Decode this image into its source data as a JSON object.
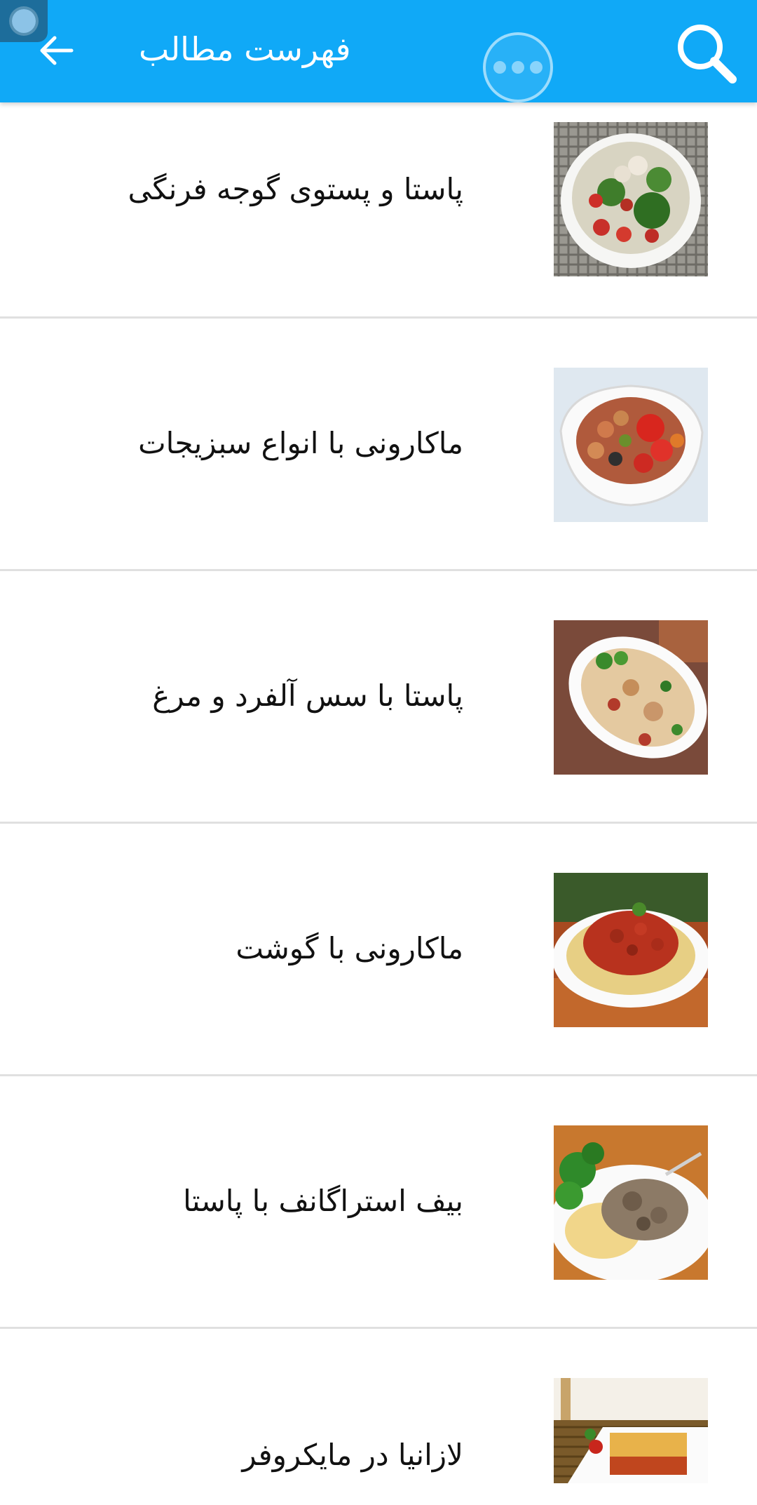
{
  "header": {
    "title": "فهرست مطالب",
    "accent_color": "#10a9f7",
    "back_icon": "arrow-left-icon",
    "search_icon": "search-icon",
    "overflow_icon": "more-dots-icon"
  },
  "items": [
    {
      "label": "پاستا و پستوی گوجه فرنگی",
      "image": "salad-bowl-image"
    },
    {
      "label": "ماکارونی با انواع سبزیجات",
      "image": "fusilli-vegetables-image"
    },
    {
      "label": "پاستا با سس آلفرد و مرغ",
      "image": "pasta-alfredo-chicken-image"
    },
    {
      "label": "ماکارونی با گوشت",
      "image": "spaghetti-meat-sauce-image"
    },
    {
      "label": "بیف استراگانف با پاستا",
      "image": "beef-stroganoff-image"
    },
    {
      "label": "لازانیا در مایکروفر",
      "image": "lasagna-image"
    }
  ]
}
